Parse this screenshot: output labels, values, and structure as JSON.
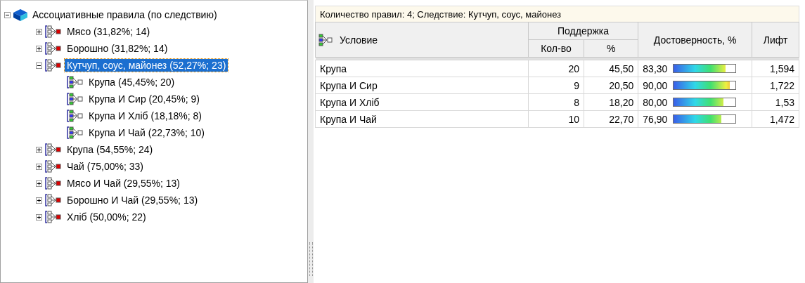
{
  "tree": {
    "label": "Ассоциативные правила (по следствию)",
    "expanded": true,
    "selected": false,
    "children": [
      {
        "label": "Мясо (31,82%; 14)",
        "expanded": false,
        "selected": false
      },
      {
        "label": "Борошно (31,82%; 14)",
        "expanded": false,
        "selected": false
      },
      {
        "label": "Кутчуп, соус, майонез (52,27%; 23)",
        "expanded": true,
        "selected": true,
        "children": [
          {
            "label": "Крупа (45,45%; 20)",
            "selected": false
          },
          {
            "label": "Крупа И Сир (20,45%; 9)",
            "selected": false
          },
          {
            "label": "Крупа И Хліб (18,18%; 8)",
            "selected": false
          },
          {
            "label": "Крупа И Чай (22,73%; 10)",
            "selected": false
          }
        ]
      },
      {
        "label": "Крупа (54,55%; 24)",
        "expanded": false,
        "selected": false
      },
      {
        "label": "Чай (75,00%; 33)",
        "expanded": false,
        "selected": false
      },
      {
        "label": "Мясо И Чай (29,55%; 13)",
        "expanded": false,
        "selected": false
      },
      {
        "label": "Борошно И Чай (29,55%; 13)",
        "expanded": false,
        "selected": false
      },
      {
        "label": "Хліб (50,00%; 22)",
        "expanded": false,
        "selected": false
      }
    ]
  },
  "summary": "Количество правил: 4; Следствие: Кутчуп, соус, майонез",
  "table": {
    "columns": {
      "condition": "Условие",
      "support": "Поддержка",
      "count": "Кол-во",
      "percent": "%",
      "confidence": "Достоверность, %",
      "lift": "Лифт"
    },
    "rows": [
      {
        "condition": "Крупа",
        "count": "20",
        "percent": "45,50",
        "confidence": "83,30",
        "level": 0.833,
        "lift": "1,594"
      },
      {
        "condition": "Крупа И Сир",
        "count": "9",
        "percent": "20,50",
        "confidence": "90,00",
        "level": 0.9,
        "lift": "1,722"
      },
      {
        "condition": "Крупа И Хліб",
        "count": "8",
        "percent": "18,20",
        "confidence": "80,00",
        "level": 0.8,
        "lift": "1,53"
      },
      {
        "condition": "Крупа И Чай",
        "count": "10",
        "percent": "22,70",
        "confidence": "76,90",
        "level": 0.769,
        "lift": "1,472"
      }
    ]
  }
}
